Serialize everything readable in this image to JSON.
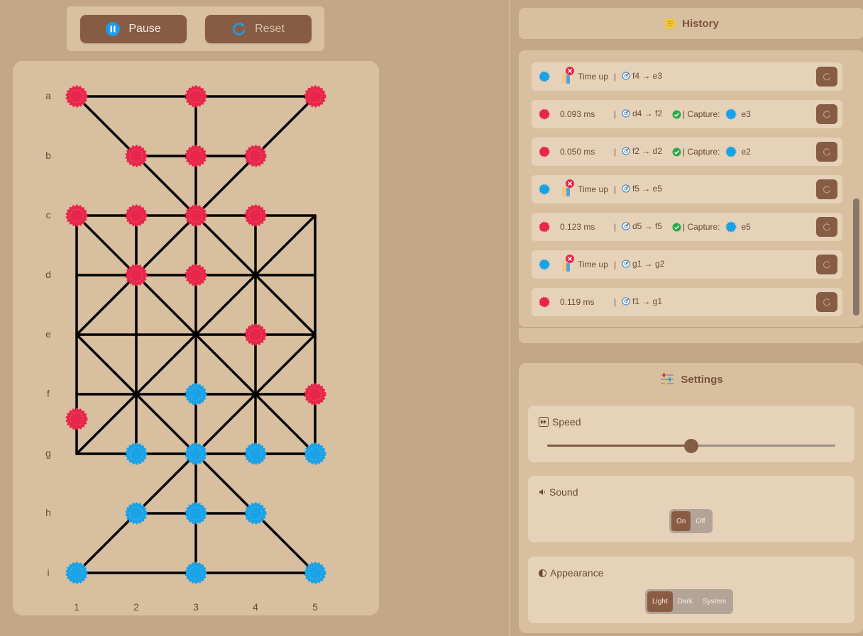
{
  "controls": {
    "pause_label": "Pause",
    "reset_label": "Reset"
  },
  "board": {
    "row_labels": [
      "a",
      "b",
      "c",
      "d",
      "e",
      "f",
      "g",
      "h",
      "i"
    ],
    "col_labels": [
      "1",
      "2",
      "3",
      "4",
      "5"
    ],
    "colors": {
      "red": "#e8254a",
      "blue": "#1aa2e6",
      "line": "#000000"
    },
    "red_pieces": [
      "a1",
      "a3",
      "a5",
      "b2",
      "b3",
      "b4",
      "c1",
      "c2",
      "c3",
      "c4",
      "d2",
      "d3",
      "e4",
      "f5",
      "f/g-1"
    ],
    "blue_pieces": [
      "f3",
      "g2",
      "g3",
      "g4",
      "g5",
      "h2",
      "h3",
      "h4",
      "i1",
      "i3",
      "i5"
    ]
  },
  "history": {
    "title": "History",
    "rows": [
      {
        "player": "blue",
        "status": "Time up",
        "timeout": true,
        "move": "f4 → e3",
        "capture": ""
      },
      {
        "player": "red",
        "status": "0.093 ms",
        "timeout": false,
        "move": "d4 → f2",
        "capture": "e3"
      },
      {
        "player": "red",
        "status": "0.050 ms",
        "timeout": false,
        "move": "f2 → d2",
        "capture": "e2"
      },
      {
        "player": "blue",
        "status": "Time up",
        "timeout": true,
        "move": "f5 → e5",
        "capture": ""
      },
      {
        "player": "red",
        "status": "0.123 ms",
        "timeout": false,
        "move": "d5 → f5",
        "capture": "e5"
      },
      {
        "player": "blue",
        "status": "Time up",
        "timeout": true,
        "move": "g1 → g2",
        "capture": ""
      },
      {
        "player": "red",
        "status": "0.119 ms",
        "timeout": false,
        "move": "f1 → g1",
        "capture": ""
      }
    ],
    "separator": "|",
    "capture_label": "| Capture:"
  },
  "settings": {
    "title": "Settings",
    "speed_label": "Speed",
    "speed_value": 0.5,
    "sound_label": "Sound",
    "sound_options": [
      "On",
      "Off"
    ],
    "sound_selected": "On",
    "appearance_label": "Appearance",
    "appearance_options": [
      "Light",
      "Dark",
      "System"
    ],
    "appearance_selected": "Light"
  }
}
